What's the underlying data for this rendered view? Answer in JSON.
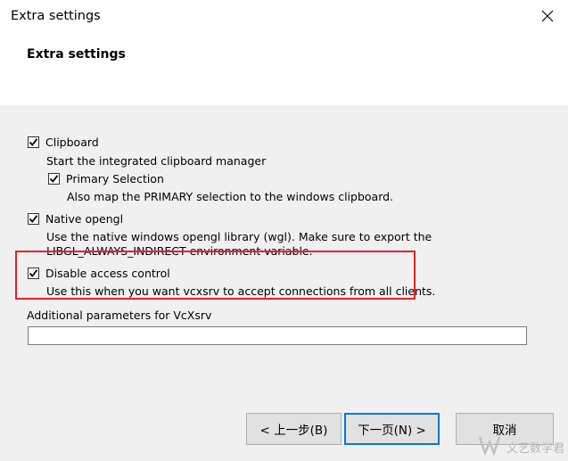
{
  "window": {
    "title": "Extra settings"
  },
  "header": {
    "title": "Extra settings"
  },
  "options": {
    "clipboard": {
      "label": "Clipboard",
      "checked": true,
      "description": "Start the integrated clipboard manager"
    },
    "primary_selection": {
      "label": "Primary Selection",
      "checked": true,
      "description": "Also map the PRIMARY selection to the windows clipboard."
    },
    "native_opengl": {
      "label": "Native opengl",
      "checked": true,
      "description_line1": "Use the native windows opengl library (wgl). Make sure to export the",
      "description_line2": "LIBGL_ALWAYS_INDIRECT environment variable."
    },
    "disable_access_control": {
      "label": "Disable access control",
      "checked": true,
      "description": "Use this when you want vcxsrv to accept connections from all clients."
    }
  },
  "additional_params": {
    "label": "Additional parameters for VcXsrv",
    "value": ""
  },
  "buttons": {
    "back": "< 上一步(B)",
    "next": "下一页(N) >",
    "cancel": "取消"
  },
  "watermark": {
    "text": "文艺数学君"
  },
  "colors": {
    "highlight": "#e0222c",
    "dialog_bg": "#f0f0f0"
  }
}
